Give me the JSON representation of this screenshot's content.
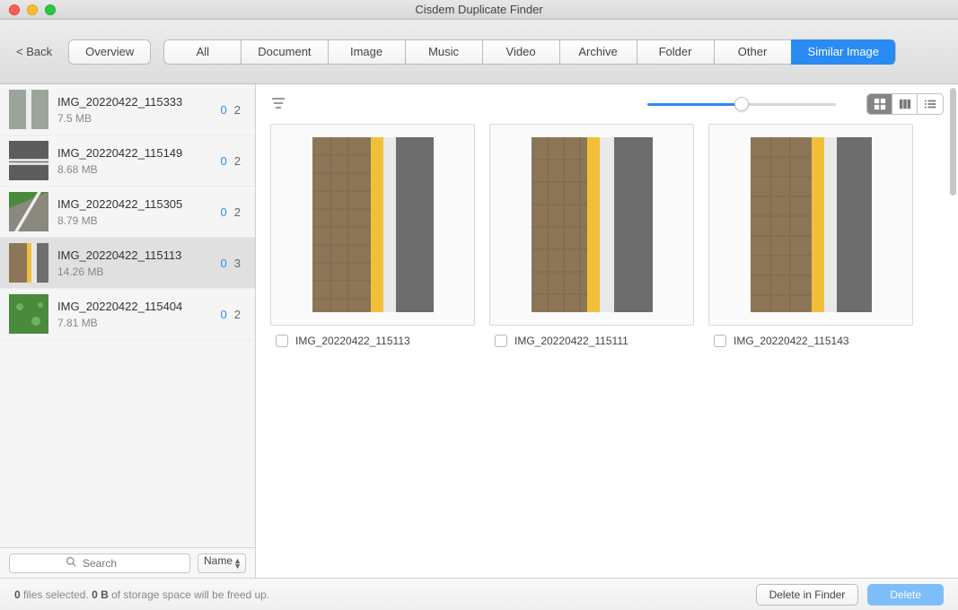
{
  "title": "Cisdem Duplicate Finder",
  "back_label": "< Back",
  "overview_label": "Overview",
  "tabs": [
    {
      "label": "All"
    },
    {
      "label": "Document"
    },
    {
      "label": "Image"
    },
    {
      "label": "Music"
    },
    {
      "label": "Video"
    },
    {
      "label": "Archive"
    },
    {
      "label": "Folder"
    },
    {
      "label": "Other"
    },
    {
      "label": "Similar Image"
    }
  ],
  "active_tab_index": 8,
  "sidebar": {
    "items": [
      {
        "name": "IMG_20220422_115333",
        "size": "7.5 MB",
        "selected_count": "0",
        "total_count": "2",
        "active": false
      },
      {
        "name": "IMG_20220422_115149",
        "size": "8.68 MB",
        "selected_count": "0",
        "total_count": "2",
        "active": false
      },
      {
        "name": "IMG_20220422_115305",
        "size": "8.79 MB",
        "selected_count": "0",
        "total_count": "2",
        "active": false
      },
      {
        "name": "IMG_20220422_115113",
        "size": "14.26 MB",
        "selected_count": "0",
        "total_count": "3",
        "active": true
      },
      {
        "name": "IMG_20220422_115404",
        "size": "7.81 MB",
        "selected_count": "0",
        "total_count": "2",
        "active": false
      }
    ],
    "search_placeholder": "Search",
    "sort_label": "Name"
  },
  "preview": {
    "zoom_pct": 50,
    "items": [
      {
        "name": "IMG_20220422_115113",
        "checked": false
      },
      {
        "name": "IMG_20220422_115111",
        "checked": false
      },
      {
        "name": "IMG_20220422_115143",
        "checked": false
      }
    ]
  },
  "status": {
    "files_selected": "0",
    "txt1": " files selected. ",
    "freed": "0 B",
    "txt2": " of storage space will be freed up."
  },
  "buttons": {
    "delete_in_finder": "Delete in Finder",
    "delete": "Delete"
  }
}
